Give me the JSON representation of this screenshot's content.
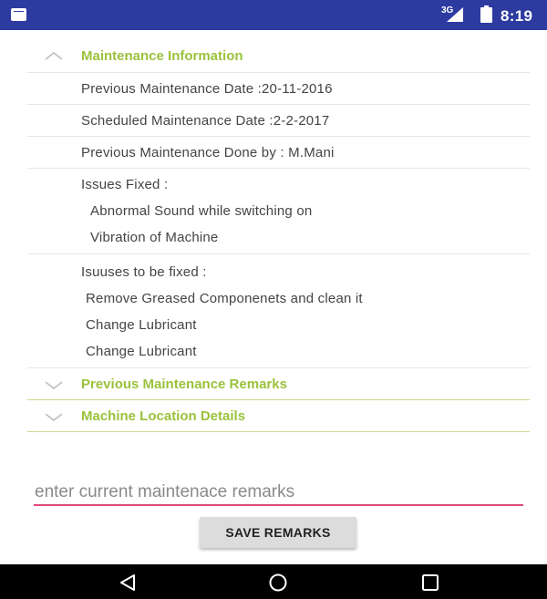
{
  "status_bar": {
    "network": "3G",
    "time": "8:19",
    "icons": [
      "sim-card-icon",
      "signal-icon",
      "battery-charging-icon"
    ]
  },
  "sections": {
    "maintenance_info": {
      "title": "Maintenance Information",
      "expanded": true,
      "previous_date": "Previous Maintenance Date :20-11-2016",
      "scheduled_date": "Scheduled Maintenance Date :2-2-2017",
      "done_by": "Previous Maintenance Done by : M.Mani",
      "issues_fixed_label": "Issues Fixed :",
      "issues_fixed": [
        "Abnormal Sound while switching on",
        "Vibration of Machine"
      ],
      "issues_to_fix_label": "Isuuses to be fixed :",
      "issues_to_fix": [
        "Remove Greased Componenets and clean it",
        "Change Lubricant",
        "Change Lubricant"
      ]
    },
    "previous_remarks": {
      "title": "Previous Maintenance Remarks",
      "expanded": false
    },
    "machine_location": {
      "title": "Machine Location Details",
      "expanded": false
    }
  },
  "remarks_input": {
    "placeholder": "enter current maintenace remarks",
    "value": ""
  },
  "save_button": {
    "label": "SAVE REMARKS"
  },
  "nav_bar": {
    "icons": [
      "back-icon",
      "home-icon",
      "recents-icon"
    ]
  },
  "colors": {
    "status_bar": "#2d3ba0",
    "section_title": "#9ac23c",
    "input_underline": "#e04a76",
    "button_bg": "#dcdcdc"
  }
}
